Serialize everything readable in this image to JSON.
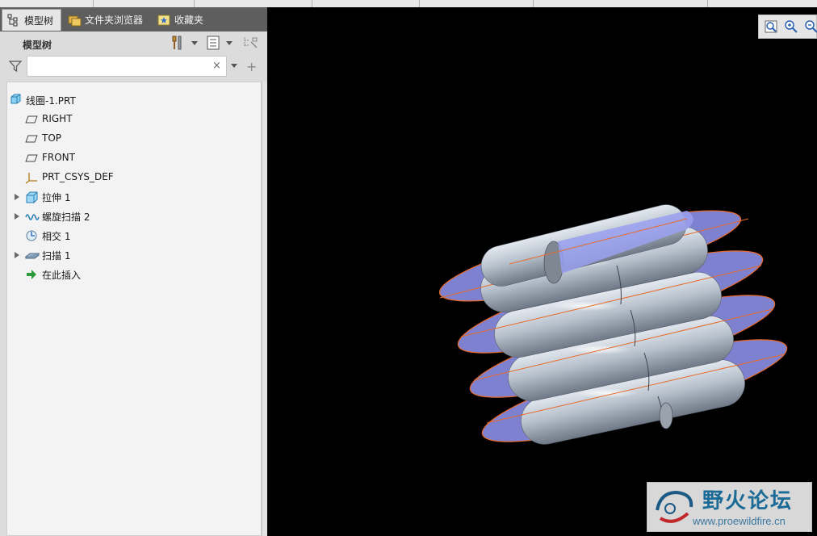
{
  "tabs": [
    {
      "label": "模型树",
      "icon": "model-tree-icon",
      "active": true
    },
    {
      "label": "文件夹浏览器",
      "icon": "folder-browser-icon",
      "active": false
    },
    {
      "label": "收藏夹",
      "icon": "favorites-icon",
      "active": false
    }
  ],
  "panel": {
    "title": "模型树"
  },
  "search": {
    "value": "",
    "clear_glyph": "×"
  },
  "tree": {
    "root": "线圈-1.PRT",
    "items": [
      {
        "label": "RIGHT",
        "icon": "datum-plane-icon",
        "expandable": false
      },
      {
        "label": "TOP",
        "icon": "datum-plane-icon",
        "expandable": false
      },
      {
        "label": "FRONT",
        "icon": "datum-plane-icon",
        "expandable": false
      },
      {
        "label": "PRT_CSYS_DEF",
        "icon": "csys-icon",
        "expandable": false
      },
      {
        "label": "拉伸 1",
        "icon": "extrude-icon",
        "expandable": true
      },
      {
        "label": "螺旋扫描 2",
        "icon": "helical-sweep-icon",
        "expandable": true
      },
      {
        "label": "相交 1",
        "icon": "intersect-icon",
        "expandable": false
      },
      {
        "label": "扫描 1",
        "icon": "sweep-icon",
        "expandable": true
      },
      {
        "label": "在此插入",
        "icon": "insert-here-arrow-icon",
        "expandable": false
      }
    ]
  },
  "watermark": {
    "title": "野火论坛",
    "url": "www.proewildfire.cn"
  },
  "colors": {
    "plane_fill": "#8b8fe6",
    "edge": "#e86a2a",
    "coil": "#b4bdc8"
  }
}
